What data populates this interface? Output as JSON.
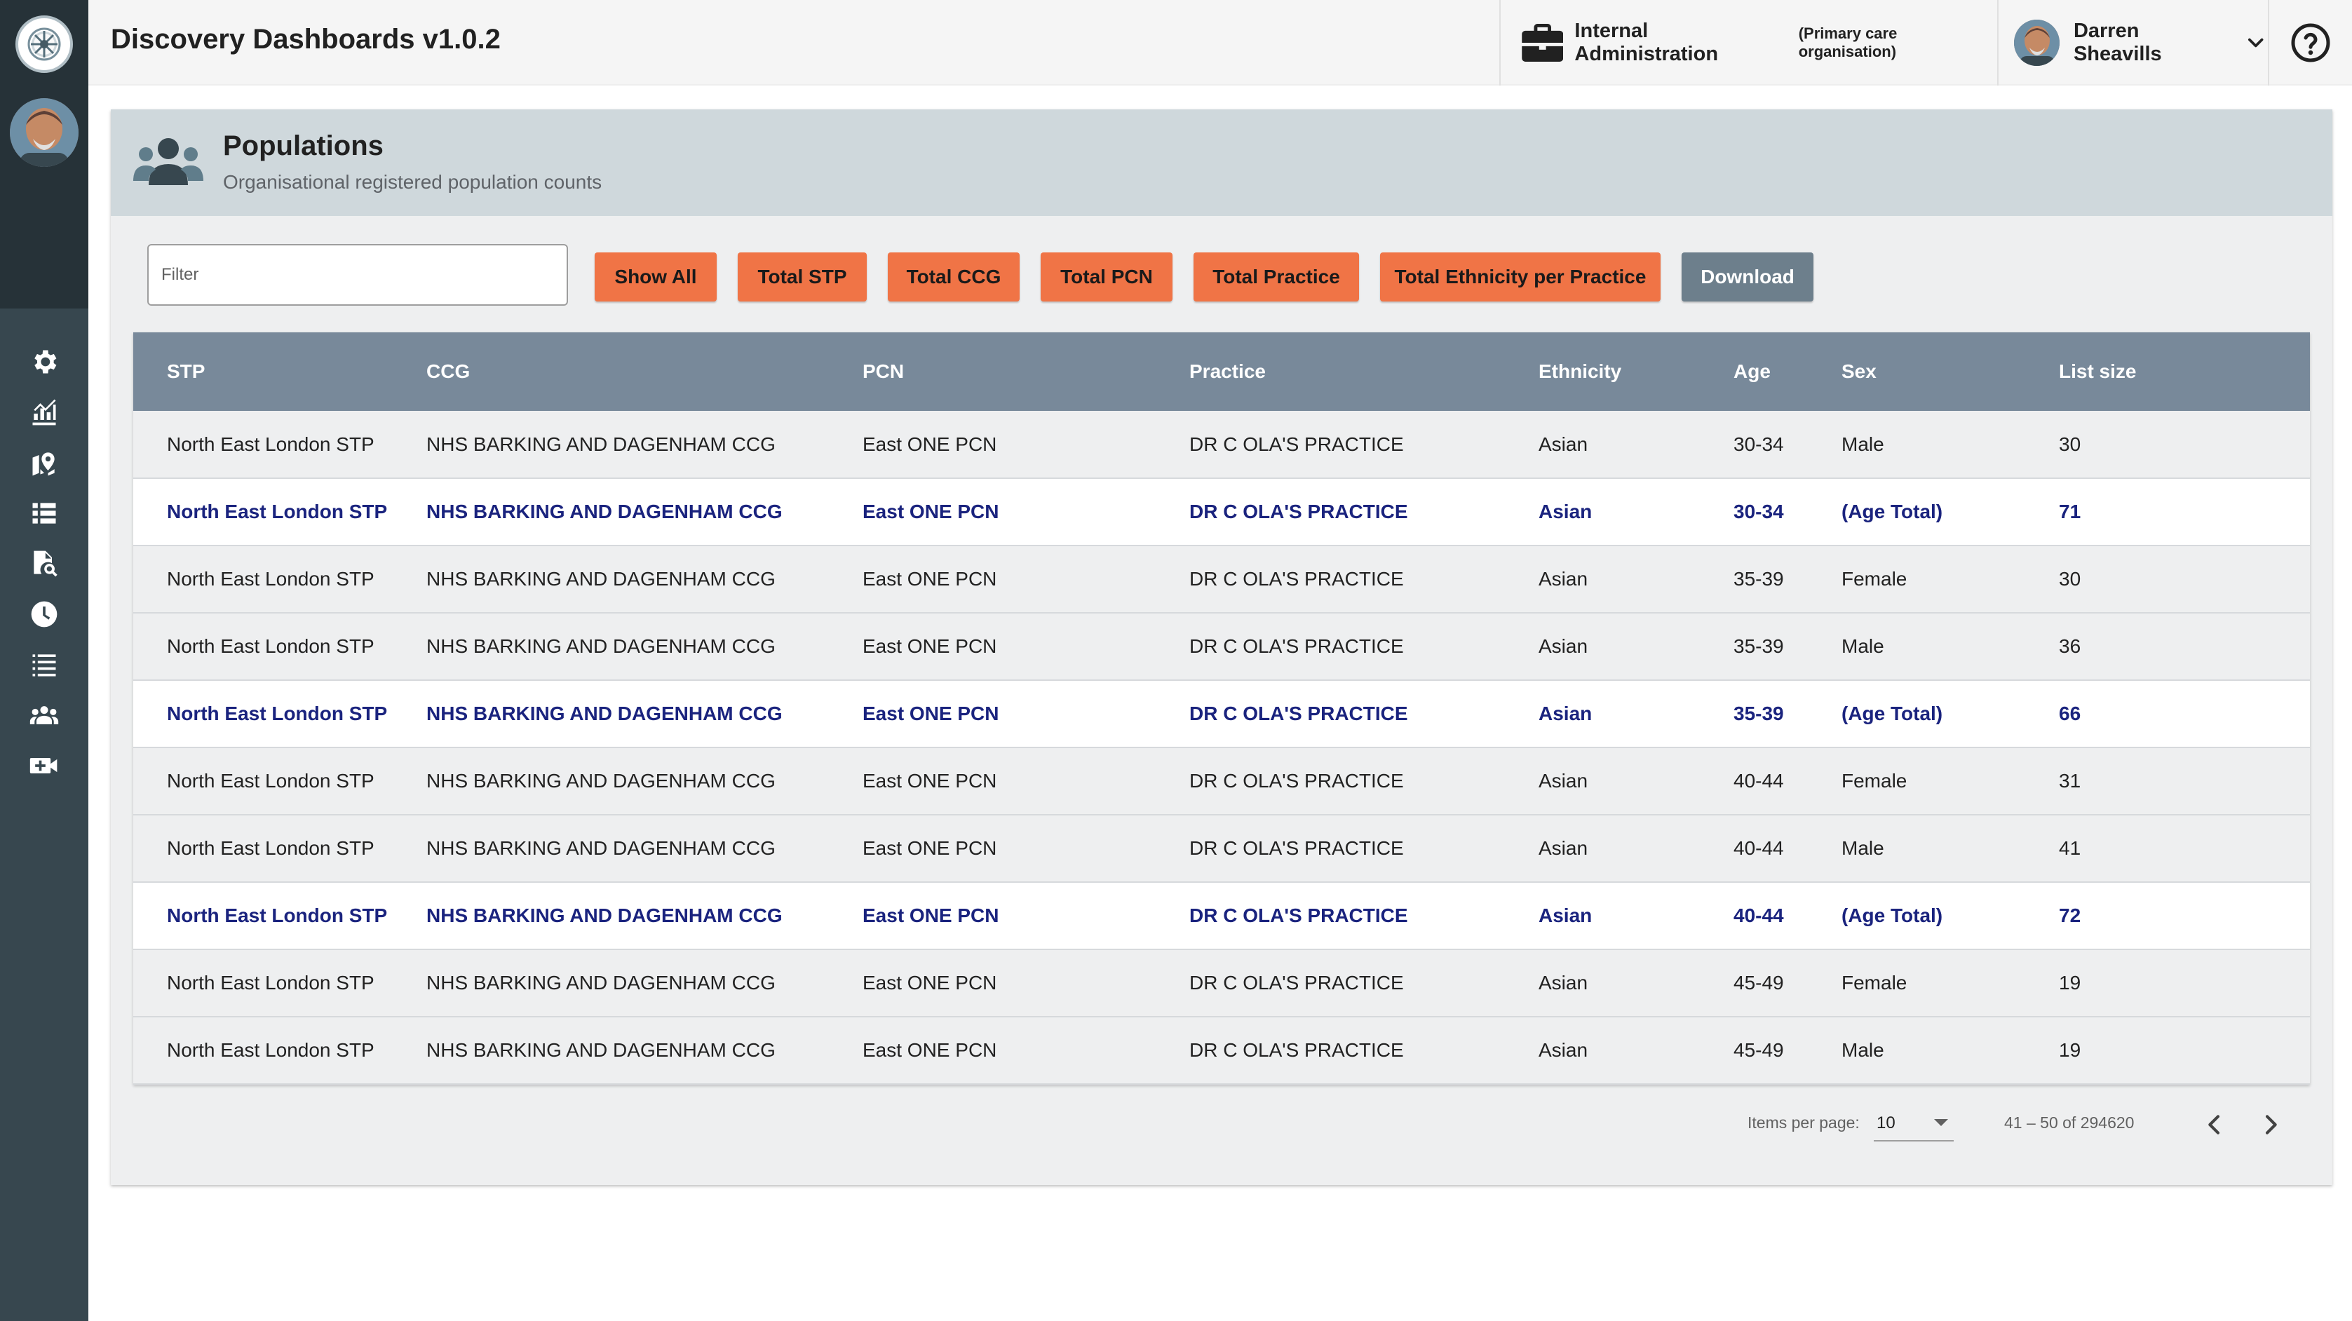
{
  "header": {
    "app_title": "Discovery Dashboards v1.0.2",
    "organisation": "Internal Administration",
    "organisation_type": "(Primary care organisation)",
    "user_name": "Darren Sheavills"
  },
  "sidebar": {
    "items": [
      {
        "icon": "settings-icon"
      },
      {
        "icon": "chart-icon"
      },
      {
        "icon": "map-icon"
      },
      {
        "icon": "list-icon"
      },
      {
        "icon": "document-search-icon"
      },
      {
        "icon": "clock-icon"
      },
      {
        "icon": "checklist-icon"
      },
      {
        "icon": "people-icon"
      },
      {
        "icon": "video-add-icon"
      }
    ]
  },
  "card": {
    "title": "Populations",
    "subtitle": "Organisational registered population counts"
  },
  "filter": {
    "placeholder": "Filter"
  },
  "buttons": {
    "show_all": "Show All",
    "total_stp": "Total STP",
    "total_ccg": "Total CCG",
    "total_pcn": "Total PCN",
    "total_practice": "Total Practice",
    "total_ethnicity": "Total Ethnicity per Practice",
    "download": "Download"
  },
  "table": {
    "columns": [
      "STP",
      "CCG",
      "PCN",
      "Practice",
      "Ethnicity",
      "Age",
      "Sex",
      "List size"
    ],
    "rows": [
      {
        "stp": "North East London STP",
        "ccg": "NHS BARKING AND DAGENHAM CCG",
        "pcn": "East ONE PCN",
        "practice": "DR C OLA'S PRACTICE",
        "ethnicity": "Asian",
        "age": "30-34",
        "sex": "Male",
        "list_size": "30",
        "total": false
      },
      {
        "stp": "North East London STP",
        "ccg": "NHS BARKING AND DAGENHAM CCG",
        "pcn": "East ONE PCN",
        "practice": "DR C OLA'S PRACTICE",
        "ethnicity": "Asian",
        "age": "30-34",
        "sex": "(Age Total)",
        "list_size": "71",
        "total": true
      },
      {
        "stp": "North East London STP",
        "ccg": "NHS BARKING AND DAGENHAM CCG",
        "pcn": "East ONE PCN",
        "practice": "DR C OLA'S PRACTICE",
        "ethnicity": "Asian",
        "age": "35-39",
        "sex": "Female",
        "list_size": "30",
        "total": false
      },
      {
        "stp": "North East London STP",
        "ccg": "NHS BARKING AND DAGENHAM CCG",
        "pcn": "East ONE PCN",
        "practice": "DR C OLA'S PRACTICE",
        "ethnicity": "Asian",
        "age": "35-39",
        "sex": "Male",
        "list_size": "36",
        "total": false
      },
      {
        "stp": "North East London STP",
        "ccg": "NHS BARKING AND DAGENHAM CCG",
        "pcn": "East ONE PCN",
        "practice": "DR C OLA'S PRACTICE",
        "ethnicity": "Asian",
        "age": "35-39",
        "sex": "(Age Total)",
        "list_size": "66",
        "total": true
      },
      {
        "stp": "North East London STP",
        "ccg": "NHS BARKING AND DAGENHAM CCG",
        "pcn": "East ONE PCN",
        "practice": "DR C OLA'S PRACTICE",
        "ethnicity": "Asian",
        "age": "40-44",
        "sex": "Female",
        "list_size": "31",
        "total": false
      },
      {
        "stp": "North East London STP",
        "ccg": "NHS BARKING AND DAGENHAM CCG",
        "pcn": "East ONE PCN",
        "practice": "DR C OLA'S PRACTICE",
        "ethnicity": "Asian",
        "age": "40-44",
        "sex": "Male",
        "list_size": "41",
        "total": false
      },
      {
        "stp": "North East London STP",
        "ccg": "NHS BARKING AND DAGENHAM CCG",
        "pcn": "East ONE PCN",
        "practice": "DR C OLA'S PRACTICE",
        "ethnicity": "Asian",
        "age": "40-44",
        "sex": "(Age Total)",
        "list_size": "72",
        "total": true
      },
      {
        "stp": "North East London STP",
        "ccg": "NHS BARKING AND DAGENHAM CCG",
        "pcn": "East ONE PCN",
        "practice": "DR C OLA'S PRACTICE",
        "ethnicity": "Asian",
        "age": "45-49",
        "sex": "Female",
        "list_size": "19",
        "total": false
      },
      {
        "stp": "North East London STP",
        "ccg": "NHS BARKING AND DAGENHAM CCG",
        "pcn": "East ONE PCN",
        "practice": "DR C OLA'S PRACTICE",
        "ethnicity": "Asian",
        "age": "45-49",
        "sex": "Male",
        "list_size": "19",
        "total": false
      }
    ]
  },
  "paginator": {
    "items_per_page_label": "Items per page:",
    "items_per_page": "10",
    "range": "41 – 50 of 294620"
  },
  "colors": {
    "sidebar": "#37474f",
    "accent_button": "#f07446",
    "download_button": "#6d7f8c",
    "table_header": "#78899a",
    "total_row_text": "#1a237e"
  }
}
